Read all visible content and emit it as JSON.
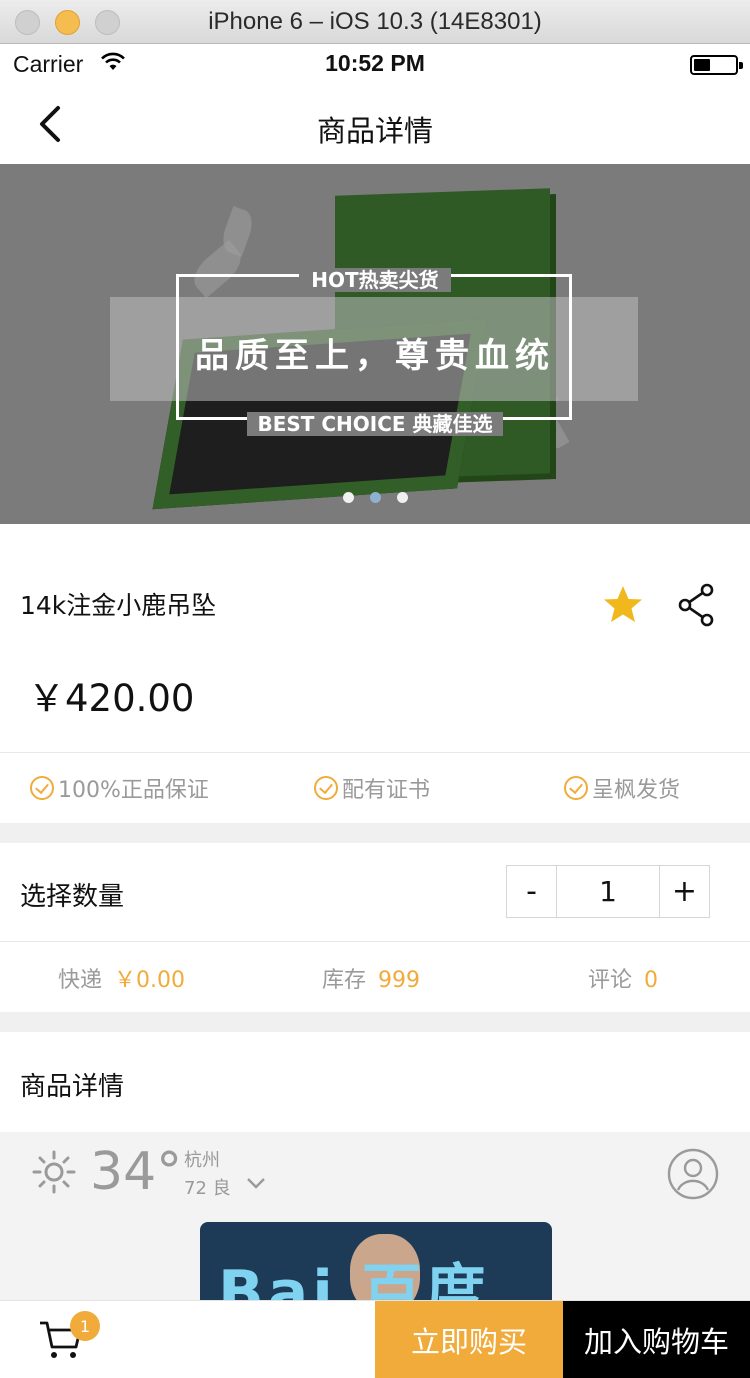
{
  "simulator": {
    "title": "iPhone 6 – iOS 10.3 (14E8301)"
  },
  "statusbar": {
    "carrier": "Carrier",
    "time": "10:52 PM"
  },
  "nav": {
    "title": "商品详情"
  },
  "banner": {
    "hot": "HOT热卖尖货",
    "slogan": "品质至上，尊贵血统",
    "best": "BEST CHOICE 典藏佳选",
    "pages": 3,
    "active_page": 2
  },
  "product": {
    "name": "14k注金小鹿吊坠",
    "price": "￥420.00",
    "favorite_color": "#f0b81c"
  },
  "guarantees": [
    {
      "label": "100%正品保证"
    },
    {
      "label": "配有证书"
    },
    {
      "label": "呈枫发货"
    }
  ],
  "quantity": {
    "label": "选择数量",
    "minus": "-",
    "value": "1",
    "plus": "+"
  },
  "meta": {
    "shipping": {
      "label": "快递",
      "value": "￥0.00"
    },
    "stock": {
      "label": "库存",
      "value": "999"
    },
    "comments": {
      "label": "评论",
      "value": "0"
    }
  },
  "details": {
    "title": "商品详情",
    "weather": {
      "temp": "34°",
      "city": "杭州",
      "aqi": "72 良"
    },
    "logo_text": "Bai 百度"
  },
  "bottom": {
    "cart_count": "1",
    "buy_now": "立即购买",
    "add_to_cart": "加入购物车",
    "accent": "#f0ab3a"
  }
}
